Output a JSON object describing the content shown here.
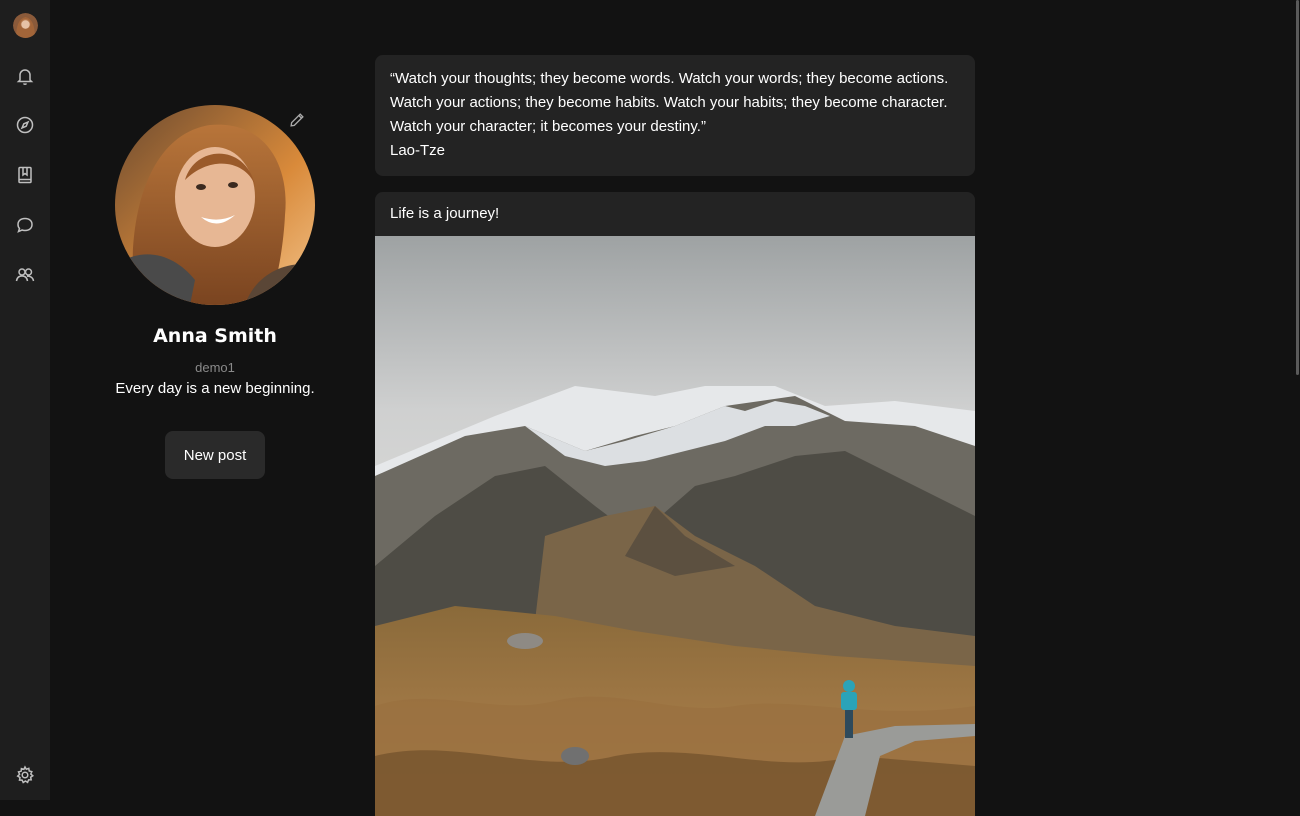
{
  "sidebar": {
    "icons": [
      "bell-icon",
      "compass-icon",
      "bookmark-book-icon",
      "chat-icon",
      "people-icon"
    ],
    "bottom_icon": "gear-icon"
  },
  "profile": {
    "name": "Anna Smith",
    "username": "demo1",
    "bio": "Every day is a new beginning.",
    "new_post_label": "New post"
  },
  "feed": {
    "quote": {
      "lines": [
        "“Watch your thoughts; they become words. Watch your words; they become actions.",
        "Watch your actions; they become habits. Watch your habits; they become character.",
        "Watch your character; it becomes your destiny.”"
      ],
      "author": "Lao-Tze"
    },
    "post": {
      "caption": "Life is a journey!"
    }
  },
  "colors": {
    "background": "#121212",
    "rail": "#1e1e1e",
    "card": "#232323",
    "button": "#2a2a2a"
  }
}
